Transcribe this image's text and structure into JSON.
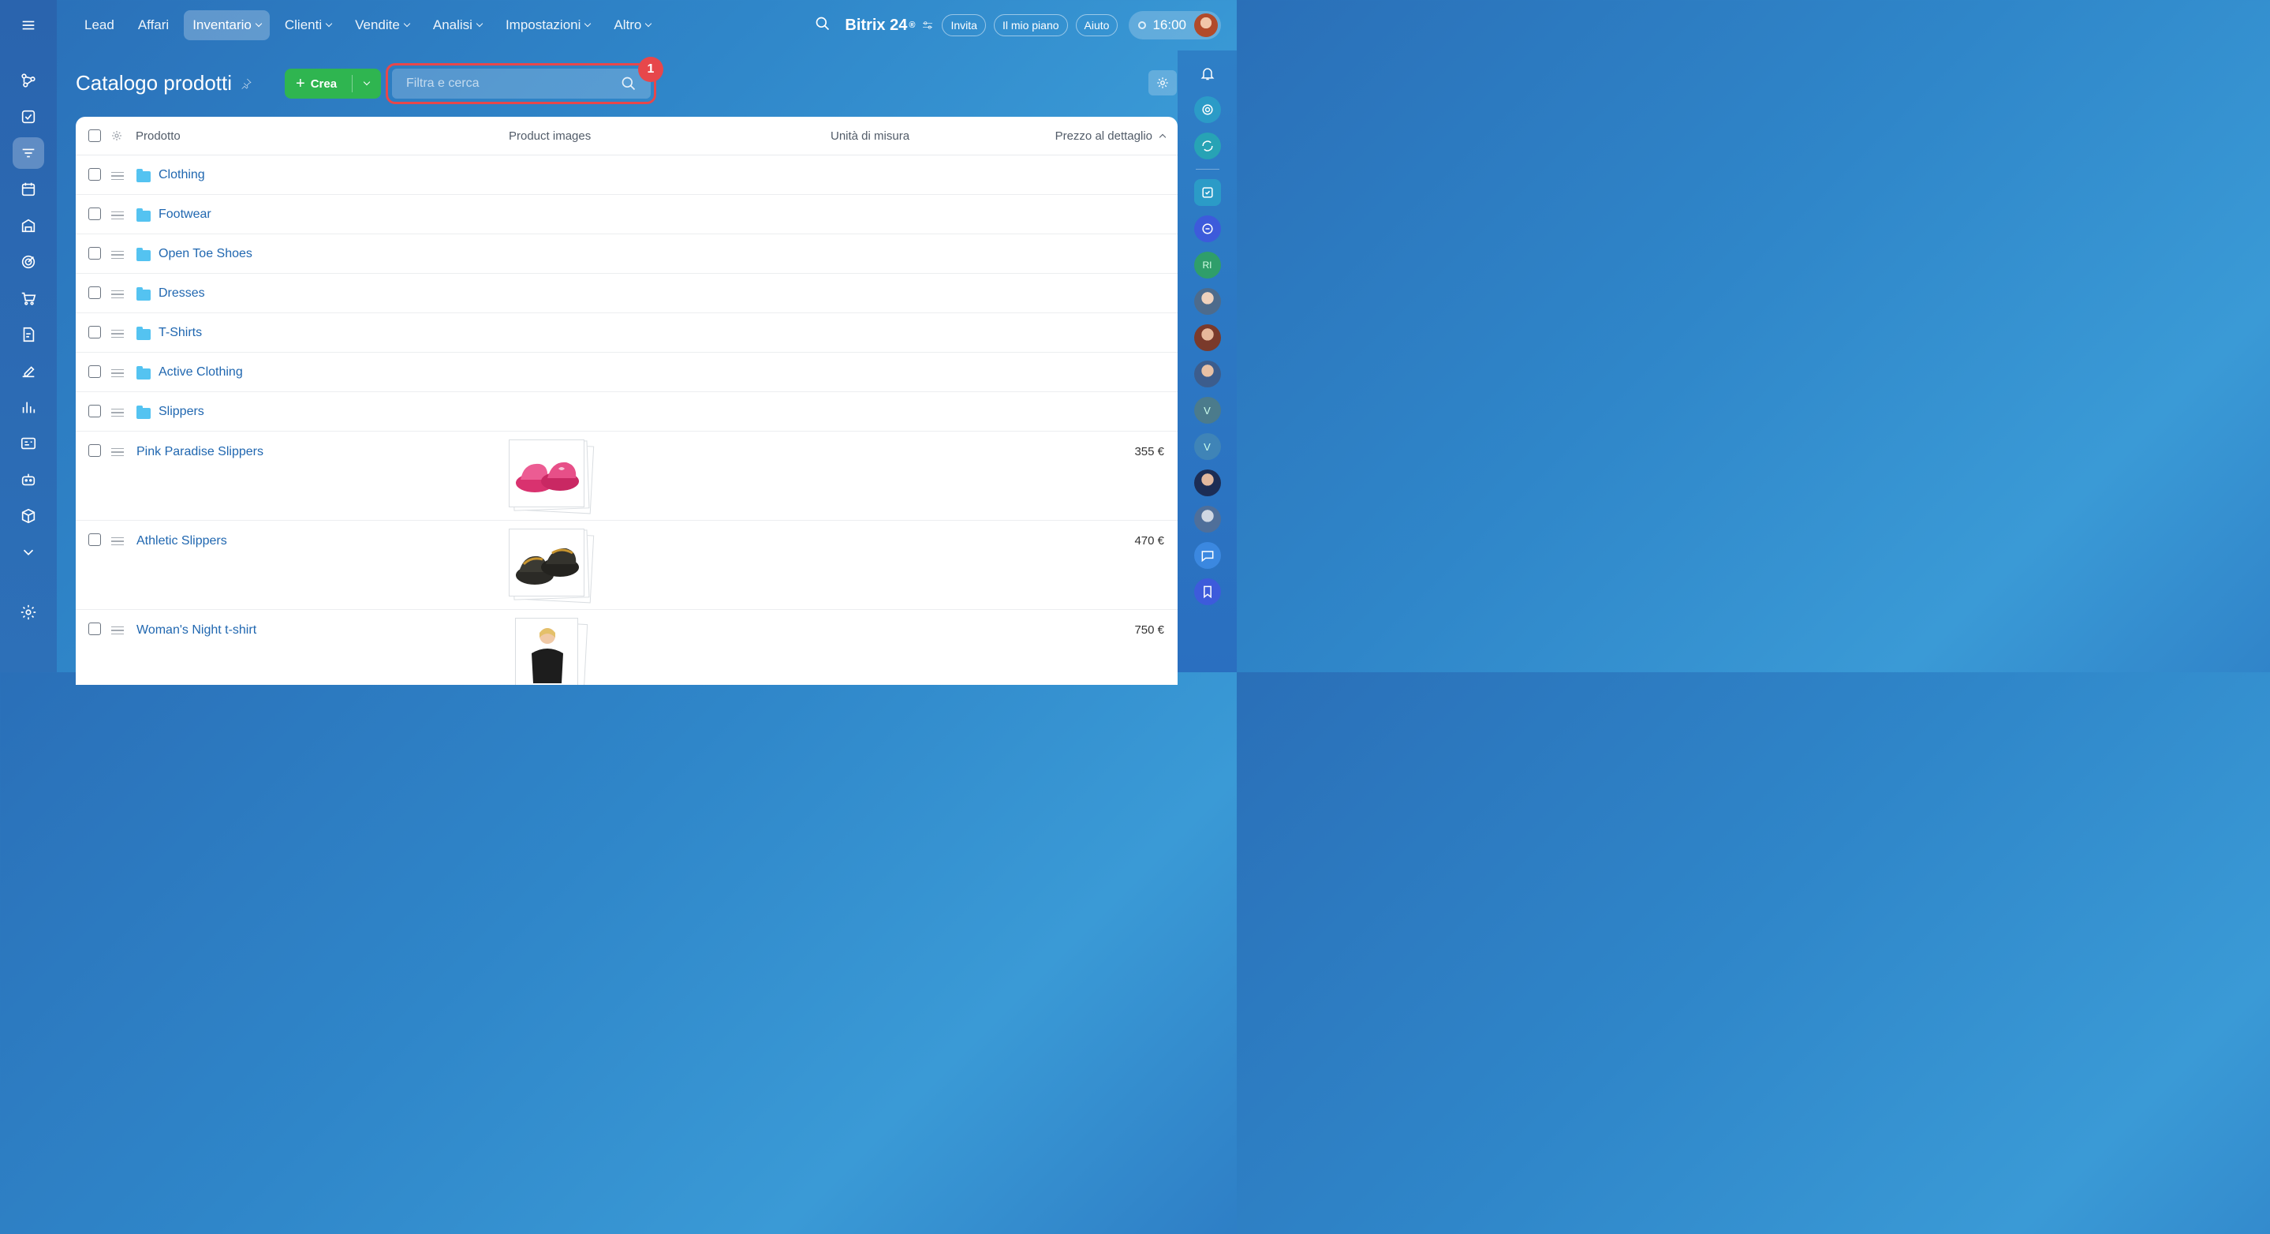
{
  "topbar": {
    "menu": [
      {
        "label": "Lead",
        "caret": false,
        "active": false
      },
      {
        "label": "Affari",
        "caret": false,
        "active": false
      },
      {
        "label": "Inventario",
        "caret": true,
        "active": true
      },
      {
        "label": "Clienti",
        "caret": true,
        "active": false
      },
      {
        "label": "Vendite",
        "caret": true,
        "active": false
      },
      {
        "label": "Analisi",
        "caret": true,
        "active": false
      },
      {
        "label": "Impostazioni",
        "caret": true,
        "active": false
      },
      {
        "label": "Altro",
        "caret": true,
        "active": false
      }
    ],
    "brand": "Bitrix 24",
    "brand_mark": "®",
    "invite": "Invita",
    "my_plan": "Il mio piano",
    "help": "Aiuto",
    "clock": "16:00"
  },
  "page": {
    "title": "Catalogo prodotti",
    "create_label": "Crea",
    "search_placeholder": "Filtra e cerca",
    "badge": "1"
  },
  "table": {
    "columns": {
      "product": "Prodotto",
      "images": "Product images",
      "unit": "Unità di misura",
      "price": "Prezzo al dettaglio"
    },
    "folders": [
      "Clothing",
      "Footwear",
      "Open Toe Shoes",
      "Dresses",
      "T-Shirts",
      "Active Clothing",
      "Slippers"
    ],
    "products": [
      {
        "name": "Pink Paradise Slippers",
        "price": "355 €",
        "image": "pink-slippers"
      },
      {
        "name": "Athletic Slippers",
        "price": "470 €",
        "image": "dark-slippers"
      },
      {
        "name": "Woman's Night t-shirt",
        "price": "750 €",
        "image": "woman-tshirt"
      }
    ]
  },
  "right_bar": {
    "avatars": [
      "RI",
      "V",
      "V"
    ]
  },
  "colors": {
    "accent_green": "#2fb550",
    "highlight_red": "#e7474b",
    "link_blue": "#2067b0",
    "folder_blue": "#54c3f1"
  }
}
